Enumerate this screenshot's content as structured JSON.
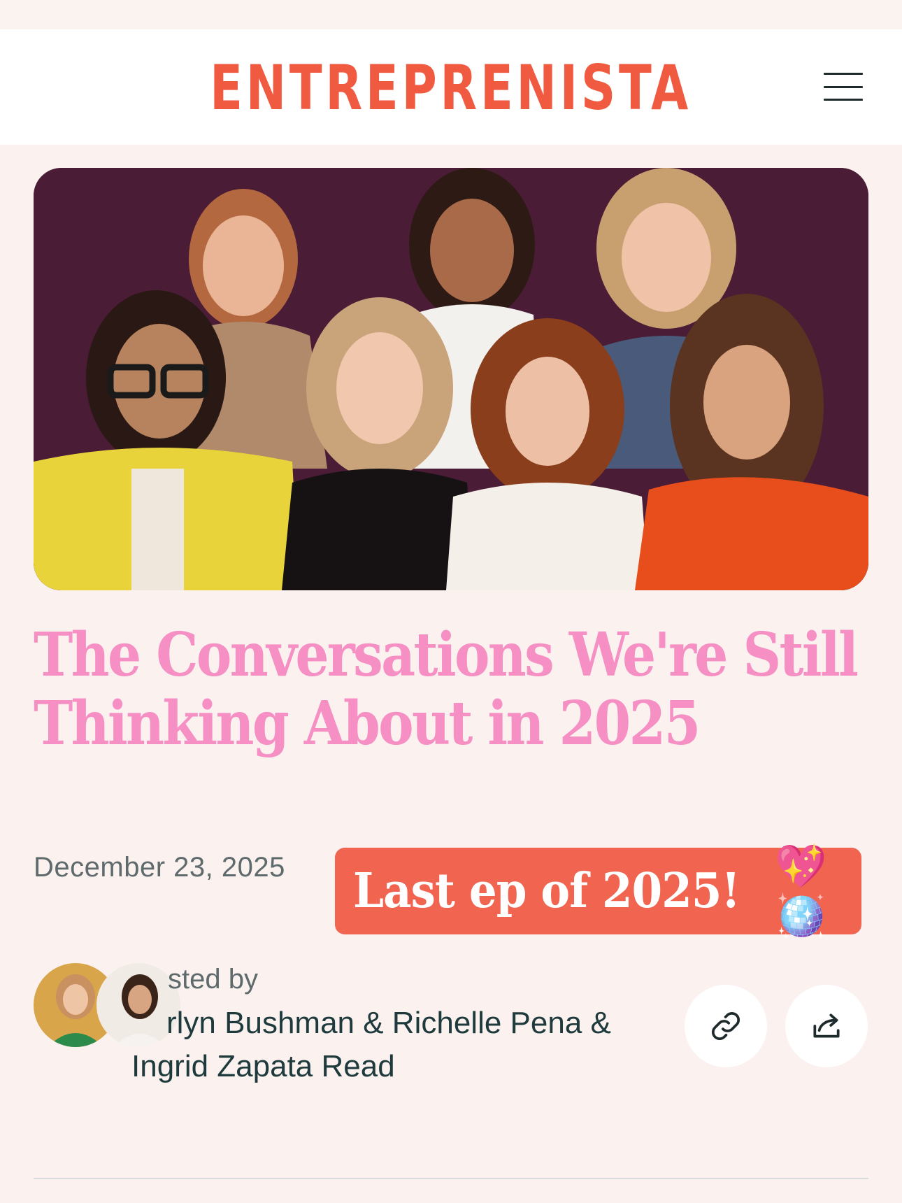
{
  "header": {
    "logo": "ENTREPRENISTA",
    "menu_icon": "hamburger-menu-icon"
  },
  "hero": {
    "image": "photo-collage-of-seven-women",
    "background_color": "#4a1c36"
  },
  "article": {
    "title": "The Conversations We're Still Thinking About in 2025",
    "date": "December 23, 2025",
    "badge": {
      "text": "Last ep of 2025!",
      "emoji": "💖🪩"
    },
    "hosted_by_label": "sted by",
    "hosts_line1": "rlyn Bushman & Richelle Pena &",
    "hosts_line2": "Ingrid Zapata Read"
  },
  "actions": {
    "copy_link_icon": "link-icon",
    "share_icon": "share-icon"
  },
  "colors": {
    "brand": "#f05a40",
    "title_pink": "#f58fc4",
    "badge_bg": "#f06450",
    "page_bg": "#fbf2ef"
  }
}
